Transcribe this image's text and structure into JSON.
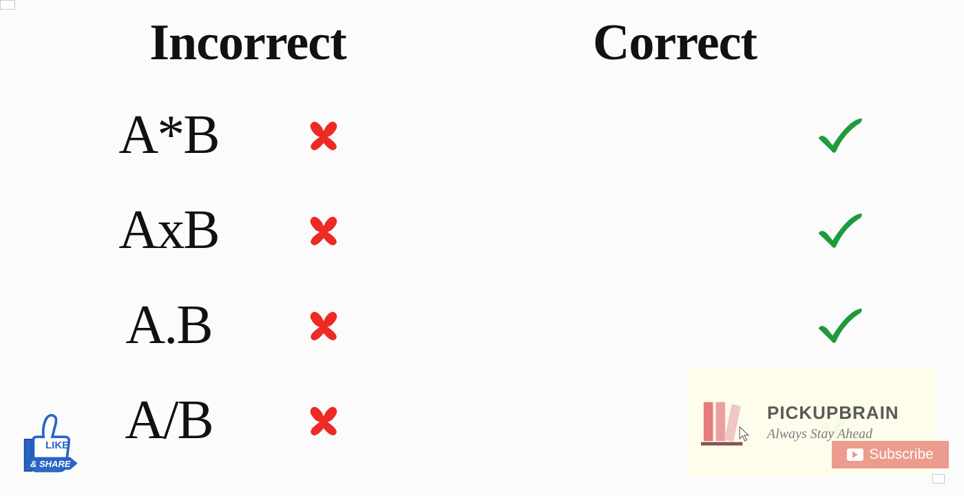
{
  "headings": {
    "incorrect": "Incorrect",
    "correct": "Correct"
  },
  "rows": {
    "incorrect": [
      "A*B",
      "AxB",
      "A.B",
      "A/B"
    ],
    "correct": [
      "",
      "",
      "",
      ""
    ]
  },
  "marks": {
    "cross_color": "#ed2a24",
    "check_color": "#1e9b3a"
  },
  "like_share": {
    "like": "LIKE",
    "share": "& SHARE"
  },
  "brand": {
    "title": "PICKUPBRAIN",
    "tagline": "Always Stay Ahead"
  },
  "subscribe": {
    "label": "Subscribe"
  }
}
